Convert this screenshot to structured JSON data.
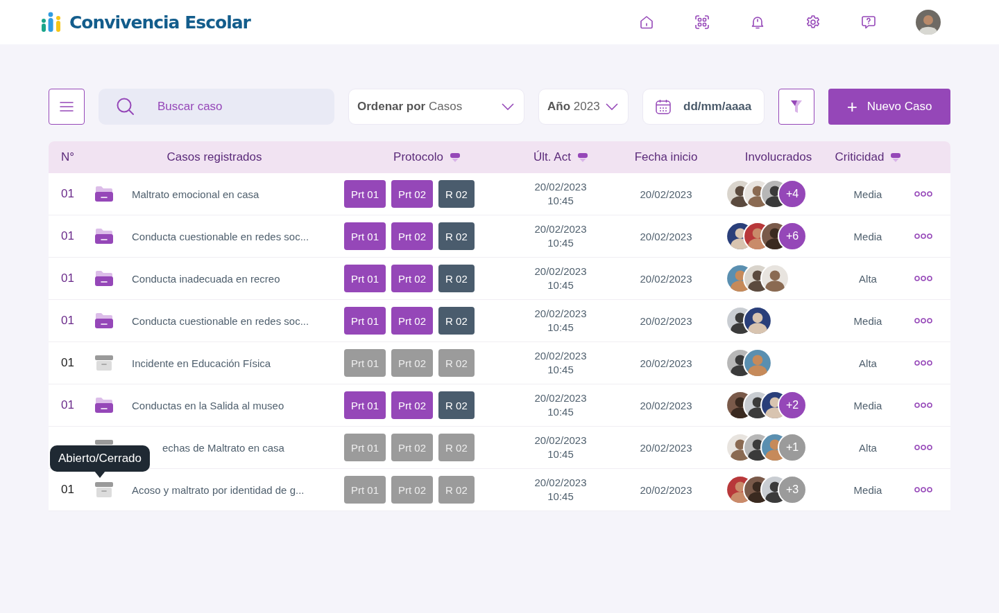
{
  "app": {
    "title": "Convivencia Escolar"
  },
  "nav": [
    {
      "kind": "home"
    },
    {
      "kind": "scan"
    },
    {
      "kind": "bell"
    },
    {
      "kind": "gear"
    },
    {
      "kind": "help"
    },
    {
      "kind": "avatar"
    }
  ],
  "toolbar": {
    "search": {
      "placeholder": "Buscar caso"
    },
    "sort": {
      "label": "Ordenar por",
      "value": "Casos"
    },
    "year": {
      "label": "Año",
      "value": "2023"
    },
    "date": {
      "placeholder": "dd/mm/aaaa"
    },
    "new_button": {
      "icon": "+",
      "label": "Nuevo Caso"
    }
  },
  "table": {
    "columns": [
      {
        "label": "N°",
        "sortable": false
      },
      {
        "label": "Casos registrados",
        "sortable": false
      },
      {
        "label": "Protocolo",
        "sortable": true
      },
      {
        "label": "Últ. Act",
        "sortable": true
      },
      {
        "label": "Fecha inicio",
        "sortable": false
      },
      {
        "label": "Involucrados",
        "sortable": false
      },
      {
        "label": "Criticidad",
        "sortable": true
      }
    ],
    "rows": [
      {
        "number": "01",
        "open": true,
        "title": "Maltrato emocional en casa",
        "tags": [
          {
            "kind": "protocol",
            "label": "Prt 01"
          },
          {
            "kind": "protocol",
            "label": "Prt 02"
          },
          {
            "kind": "report",
            "label": "R 02"
          }
        ],
        "updated_date": "20/02/2023",
        "updated_time": "10:45",
        "start": "20/02/2023",
        "extra": "+4",
        "criticality": "Media"
      },
      {
        "number": "01",
        "open": true,
        "title": "Conducta cuestionable en redes soc...",
        "tags": [
          {
            "kind": "protocol",
            "label": "Prt 01"
          },
          {
            "kind": "protocol",
            "label": "Prt 02"
          },
          {
            "kind": "report",
            "label": "R 02"
          }
        ],
        "updated_date": "20/02/2023",
        "updated_time": "10:45",
        "start": "20/02/2023",
        "extra": "+6",
        "criticality": "Media"
      },
      {
        "number": "01",
        "open": true,
        "title": "Conducta inadecuada en recreo",
        "tags": [
          {
            "kind": "protocol",
            "label": "Prt 01"
          },
          {
            "kind": "protocol",
            "label": "Prt 02"
          },
          {
            "kind": "report",
            "label": "R 02"
          }
        ],
        "updated_date": "20/02/2023",
        "updated_time": "10:45",
        "start": "20/02/2023",
        "criticality": "Alta"
      },
      {
        "number": "01",
        "open": true,
        "title": "Conducta cuestionable en redes soc...",
        "tags": [
          {
            "kind": "protocol",
            "label": "Prt 01"
          },
          {
            "kind": "protocol",
            "label": "Prt 02"
          },
          {
            "kind": "report",
            "label": "R 02"
          }
        ],
        "updated_date": "20/02/2023",
        "updated_time": "10:45",
        "start": "20/02/2023",
        "criticality": "Media"
      },
      {
        "number": "01",
        "open": false,
        "title": "Incidente en Educación Física",
        "tags": [
          {
            "kind": "protocol",
            "label": "Prt 01"
          },
          {
            "kind": "protocol",
            "label": "Prt 02"
          },
          {
            "kind": "report",
            "label": "R 02"
          }
        ],
        "updated_date": "20/02/2023",
        "updated_time": "10:45",
        "start": "20/02/2023",
        "criticality": "Alta"
      },
      {
        "number": "01",
        "open": true,
        "title": "Conductas en la Salida al museo",
        "tags": [
          {
            "kind": "protocol",
            "label": "Prt 01"
          },
          {
            "kind": "protocol",
            "label": "Prt 02"
          },
          {
            "kind": "report",
            "label": "R 02"
          }
        ],
        "updated_date": "20/02/2023",
        "updated_time": "10:45",
        "start": "20/02/2023",
        "extra": "+2",
        "criticality": "Media"
      },
      {
        "open": false,
        "title": "echas de Maltrato en casa",
        "tags": [
          {
            "kind": "protocol",
            "label": "Prt 01"
          },
          {
            "kind": "protocol",
            "label": "Prt 02"
          },
          {
            "kind": "report",
            "label": "R 02"
          }
        ],
        "updated_date": "20/02/2023",
        "updated_time": "10:45",
        "start": "20/02/2023",
        "extra": "+1",
        "criticality": "Alta"
      },
      {
        "number": "01",
        "open": false,
        "title": "Acoso y maltrato por identidad de g...",
        "tags": [
          {
            "kind": "protocol",
            "label": "Prt 01"
          },
          {
            "kind": "protocol",
            "label": "Prt 02"
          },
          {
            "kind": "report",
            "label": "R 02"
          }
        ],
        "updated_date": "20/02/2023",
        "updated_time": "10:45",
        "start": "20/02/2023",
        "extra": "+3",
        "criticality": "Media"
      }
    ]
  },
  "tooltip": {
    "text": "Abierto/Cerrado"
  }
}
